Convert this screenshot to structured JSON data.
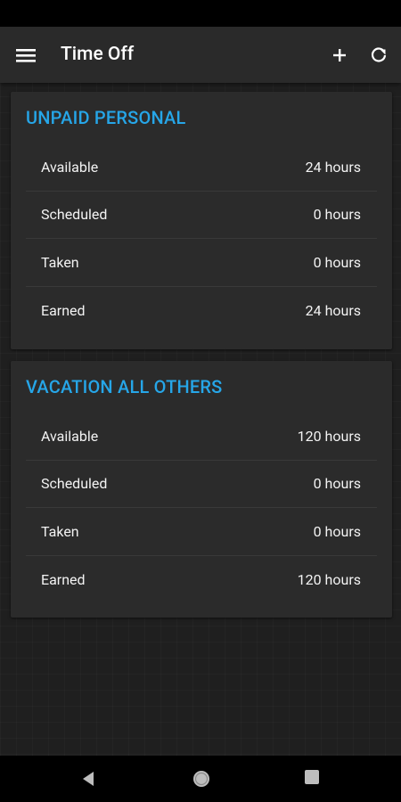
{
  "app": {
    "title": "Time Off"
  },
  "icons": {
    "menu": "hamburger-menu-icon",
    "add": "plus-icon",
    "refresh": "refresh-icon",
    "back": "back-triangle-icon",
    "home": "home-circle-icon",
    "recents": "recents-square-icon"
  },
  "colors": {
    "accent": "#26a6e8",
    "card": "#2b2b2b",
    "appbar": "#2a2a2a"
  },
  "cards": [
    {
      "title": "UNPAID PERSONAL",
      "rows": [
        {
          "label": "Available",
          "value": "24 hours"
        },
        {
          "label": "Scheduled",
          "value": "0 hours"
        },
        {
          "label": "Taken",
          "value": "0 hours"
        },
        {
          "label": "Earned",
          "value": "24 hours"
        }
      ]
    },
    {
      "title": "VACATION ALL OTHERS",
      "rows": [
        {
          "label": "Available",
          "value": "120 hours"
        },
        {
          "label": "Scheduled",
          "value": "0 hours"
        },
        {
          "label": "Taken",
          "value": "0 hours"
        },
        {
          "label": "Earned",
          "value": "120 hours"
        }
      ]
    }
  ]
}
